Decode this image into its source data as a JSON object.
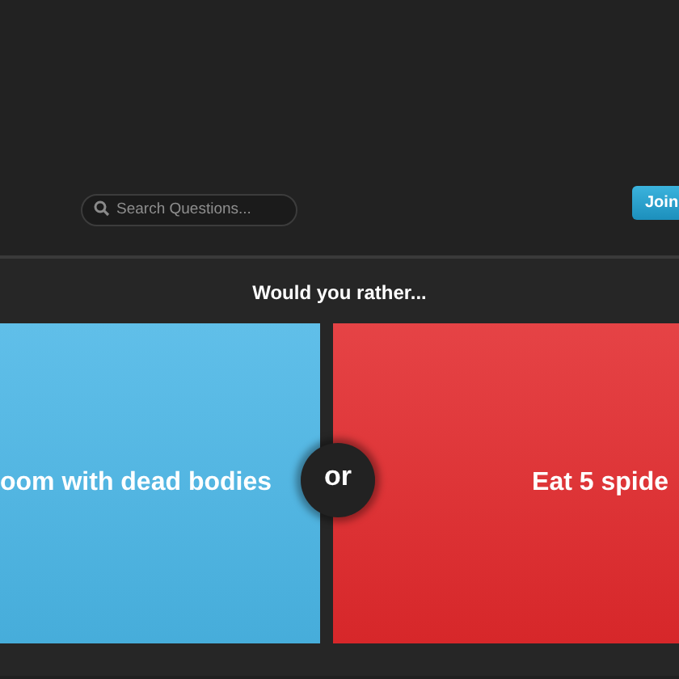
{
  "search": {
    "placeholder": "Search Questions..."
  },
  "join_button": {
    "label": "Join"
  },
  "prompt": "Would you rather...",
  "options": [
    {
      "text": "oom with dead bodies",
      "color": "#4ab6e6"
    },
    {
      "text": "Eat 5 spide",
      "color": "#e2292c"
    }
  ],
  "separator": "or"
}
